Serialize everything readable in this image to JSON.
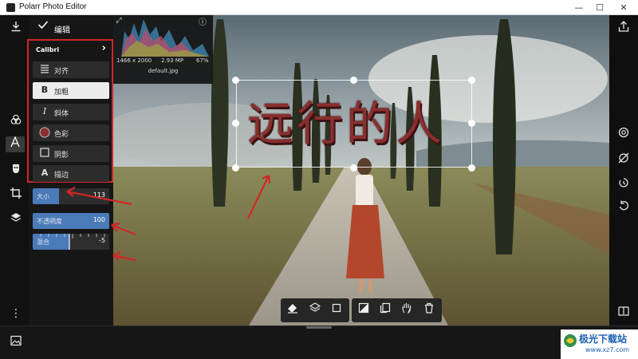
{
  "window": {
    "title": "Polarr Photo Editor",
    "minimize_glyph": "—",
    "maximize_glyph": "☐",
    "close_glyph": "✕"
  },
  "panel": {
    "confirm_label": "编辑",
    "font_name": "Calibri",
    "tools": [
      {
        "label": "对齐",
        "icon": "align-icon"
      },
      {
        "label": "加粗",
        "icon": "bold-icon",
        "glyph": "B"
      },
      {
        "label": "斜体",
        "icon": "italic-icon",
        "glyph": "I"
      },
      {
        "label": "色彩",
        "icon": "color-swatch-icon"
      },
      {
        "label": "阴影",
        "icon": "shadow-icon"
      },
      {
        "label": "描边",
        "icon": "stroke-icon",
        "glyph": "A"
      }
    ],
    "sliders": [
      {
        "name": "大小",
        "value": "113",
        "fill": 0.34
      },
      {
        "name": "不透明度",
        "value": "100",
        "fill": 1.0
      },
      {
        "name": "混合",
        "value": "-5",
        "fill": 0.48
      }
    ]
  },
  "histogram": {
    "dimensions": "1466 x 2000",
    "megapixels": "2.93 MP",
    "zoom": "67%",
    "filename": "default.jpg"
  },
  "canvas": {
    "overlay_text": "远行的人",
    "text_color": "#8a2e2e"
  },
  "watermark": {
    "brand": "极光下载站",
    "url": "www.xz7.com"
  },
  "colors": {
    "accent_slider": "#4a7ab8",
    "annotation_red": "#d32626"
  }
}
